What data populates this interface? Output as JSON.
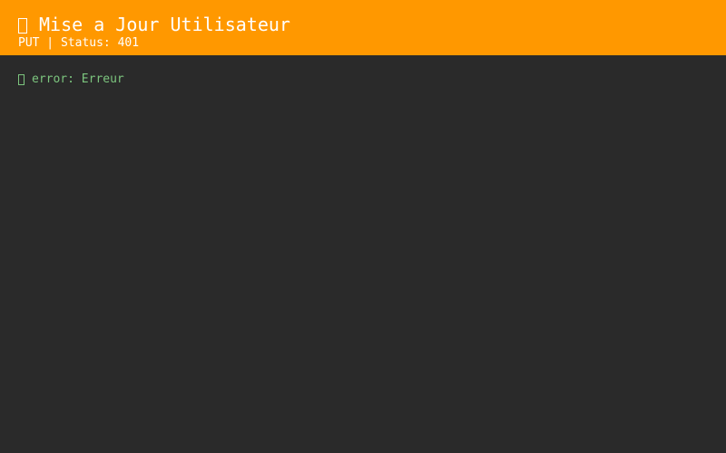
{
  "header": {
    "icon": "missing-glyph-icon",
    "title": "Mise a Jour Utilisateur",
    "method": "PUT",
    "separator": " | ",
    "status_label": "Status: ",
    "status_code": "401",
    "background_color": "#ff9800"
  },
  "response": {
    "fields": [
      {
        "icon": "missing-glyph-icon",
        "key": "error",
        "separator": ": ",
        "value": "Erreur",
        "color": "#7cc57e"
      }
    ]
  },
  "theme": {
    "background": "#2a2a2a",
    "text": "#ffffff"
  }
}
